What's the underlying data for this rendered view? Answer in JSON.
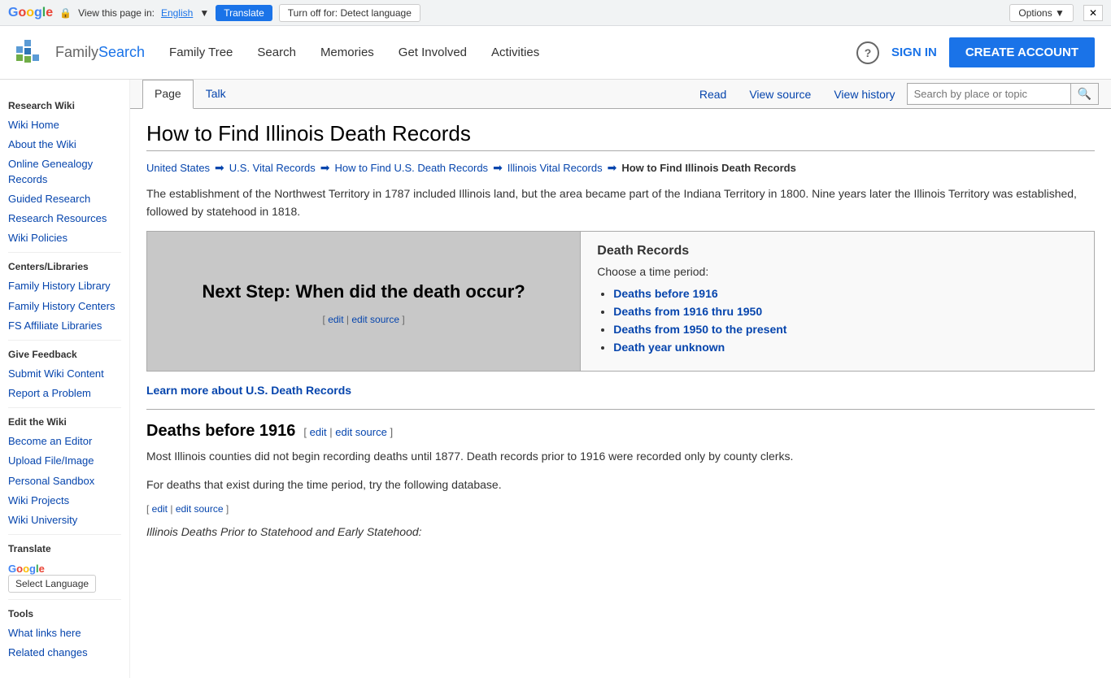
{
  "translate_bar": {
    "view_page_in": "View this page in:",
    "language": "English",
    "translate_btn": "Translate",
    "turnoff_btn": "Turn off for: Detect language",
    "options_btn": "Options ▼"
  },
  "header": {
    "logo_text_family": "Family",
    "logo_text_search": "Search",
    "nav": {
      "family_tree": "Family Tree",
      "search": "Search",
      "memories": "Memories",
      "get_involved": "Get Involved",
      "activities": "Activities"
    },
    "sign_in": "SIGN IN",
    "create_account": "CREATE ACCOUNT",
    "help_icon": "?"
  },
  "sidebar": {
    "research_wiki_title": "Research Wiki",
    "links_research": [
      {
        "label": "Wiki Home",
        "href": "#"
      },
      {
        "label": "About the Wiki",
        "href": "#"
      },
      {
        "label": "Online Genealogy Records",
        "href": "#"
      },
      {
        "label": "Guided Research",
        "href": "#"
      },
      {
        "label": "Research Resources",
        "href": "#"
      },
      {
        "label": "Wiki Policies",
        "href": "#"
      }
    ],
    "centers_title": "Centers/Libraries",
    "links_centers": [
      {
        "label": "Family History Library",
        "href": "#"
      },
      {
        "label": "Family History Centers",
        "href": "#"
      },
      {
        "label": "FS Affiliate Libraries",
        "href": "#"
      }
    ],
    "give_feedback_title": "Give Feedback",
    "links_feedback": [
      {
        "label": "Submit Wiki Content",
        "href": "#"
      },
      {
        "label": "Report a Problem",
        "href": "#"
      }
    ],
    "edit_wiki_title": "Edit the Wiki",
    "links_edit": [
      {
        "label": "Become an Editor",
        "href": "#"
      },
      {
        "label": "Upload File/Image",
        "href": "#"
      },
      {
        "label": "Personal Sandbox",
        "href": "#"
      },
      {
        "label": "Wiki Projects",
        "href": "#"
      },
      {
        "label": "Wiki University",
        "href": "#"
      }
    ],
    "translate_title": "Translate",
    "select_language_btn": "Select Language",
    "tools_title": "Tools",
    "links_tools": [
      {
        "label": "What links here",
        "href": "#"
      },
      {
        "label": "Related changes",
        "href": "#"
      }
    ]
  },
  "tabs": {
    "page": "Page",
    "talk": "Talk",
    "read": "Read",
    "view_source": "View source",
    "view_history": "View history",
    "search_placeholder": "Search by place or topic"
  },
  "article": {
    "title": "How to Find Illinois Death Records",
    "breadcrumb": [
      {
        "label": "United States",
        "href": "#"
      },
      {
        "label": "U.S. Vital Records",
        "href": "#"
      },
      {
        "label": "How to Find U.S. Death Records",
        "href": "#"
      },
      {
        "label": "Illinois Vital Records",
        "href": "#"
      },
      {
        "label": "How to Find Illinois Death Records",
        "current": true
      }
    ],
    "intro": "The establishment of the Northwest Territory in 1787 included Illinois land, but the area became part of the Indiana Territory in 1800. Nine years later the Illinois Territory was established, followed by statehood in 1818.",
    "infobox": {
      "left_text": "Next Step: When did the death occur?",
      "edit_label": "edit",
      "edit_source_label": "edit source",
      "right_heading": "Death Records",
      "right_subheading": "Choose a time period:",
      "right_links": [
        "Deaths before 1916",
        "Deaths from 1916 thru 1950",
        "Deaths from 1950 to the present",
        "Death year unknown"
      ]
    },
    "learn_more": "Learn more about U.S. Death Records",
    "section1": {
      "heading": "Deaths before 1916",
      "edit_label": "edit",
      "edit_source_label": "edit source",
      "para1": "Most Illinois counties did not begin recording deaths until 1877. Death records prior to 1916 were recorded only by county clerks.",
      "para2": "For deaths that exist during the time period, try the following database.",
      "inline_edit_label": "edit",
      "inline_edit_source_label": "edit source",
      "subheading": "Illinois Deaths Prior to Statehood and Early Statehood:"
    }
  }
}
